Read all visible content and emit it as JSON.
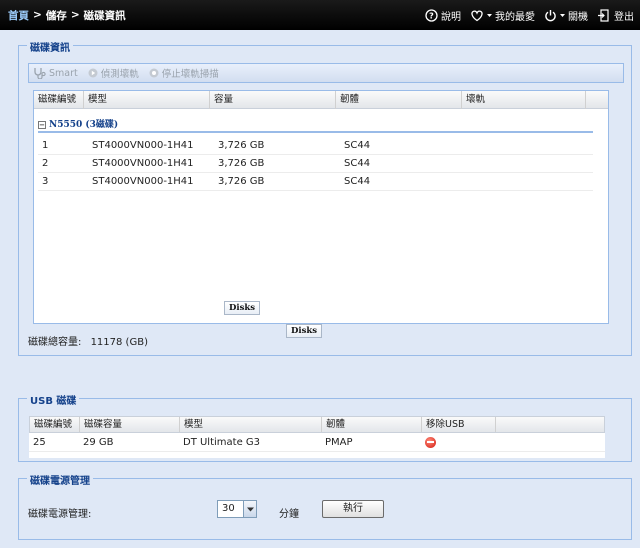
{
  "breadcrumb": {
    "home": "首頁",
    "sep1": ">",
    "storage": "儲存",
    "sep2": ">",
    "current": "磁碟資訊"
  },
  "top_links": {
    "help": "說明",
    "favorites": "我的最愛",
    "shutdown": "關機",
    "logout": "登出"
  },
  "disk_info": {
    "legend": "磁碟資訊",
    "toolbar": {
      "smart": "Smart",
      "scan": "偵測壞軌",
      "stop_scan": "停止壞軌掃描"
    },
    "columns": [
      "磁碟編號",
      "模型",
      "容量",
      "韌體",
      "壞軌"
    ],
    "group_label": "N5550 (3磁碟)",
    "group_toggle": "−",
    "rows": [
      {
        "no": "1",
        "model": "ST4000VN000-1H41",
        "capacity": "3,726 GB",
        "firmware": "SC44",
        "bad": ""
      },
      {
        "no": "2",
        "model": "ST4000VN000-1H41",
        "capacity": "3,726 GB",
        "firmware": "SC44",
        "bad": ""
      },
      {
        "no": "3",
        "model": "ST4000VN000-1H41",
        "capacity": "3,726 GB",
        "firmware": "SC44",
        "bad": ""
      }
    ],
    "tag1": "Disks",
    "tag2": "Disks",
    "total_label": "磁碟總容量:",
    "total_value": "11178 (GB)"
  },
  "usb": {
    "legend": "USB 磁碟",
    "columns": [
      "磁碟編號",
      "磁碟容量",
      "模型",
      "韌體",
      "移除USB"
    ],
    "rows": [
      {
        "no": "25",
        "capacity": "29 GB",
        "model": "DT Ultimate G3",
        "firmware": "PMAP"
      }
    ]
  },
  "power": {
    "legend": "磁碟電源管理",
    "label": "磁碟電源管理:",
    "selected": "30",
    "unit": "分鐘",
    "execute": "執行"
  },
  "colors": {
    "accent": "#15428b",
    "border": "#99bbe8",
    "panel_bg": "#dfe8f6",
    "topbar": "#000000",
    "remove_icon": "#d21a0f"
  }
}
